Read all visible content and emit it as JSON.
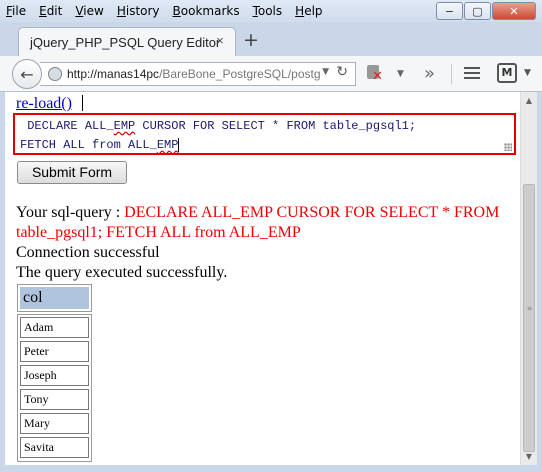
{
  "menubar": {
    "items": [
      {
        "label": "File",
        "mnemonic": "F",
        "rest": "ile"
      },
      {
        "label": "Edit",
        "mnemonic": "E",
        "rest": "dit"
      },
      {
        "label": "View",
        "mnemonic": "V",
        "rest": "iew"
      },
      {
        "label": "History",
        "mnemonic": "H",
        "rest": "istory"
      },
      {
        "label": "Bookmarks",
        "mnemonic": "B",
        "rest": "ookmarks"
      },
      {
        "label": "Tools",
        "mnemonic": "T",
        "rest": "ools"
      },
      {
        "label": "Help",
        "mnemonic": "H",
        "rest": "elp"
      }
    ]
  },
  "window_controls": {
    "minimize": "−",
    "maximize": "▢",
    "close": "✕"
  },
  "tab": {
    "title": "jQuery_PHP_PSQL Query Editor",
    "close": "×",
    "new_tab": "+"
  },
  "navbar": {
    "url_host": "http://manas14pc",
    "url_rest": "/BareBone_PostgreSQL/postg",
    "reload": "↻",
    "back": "←"
  },
  "page": {
    "reload_link": "re-load()",
    "query_line1_prefix": " DECLARE ALL_",
    "query_line1_spell": "EMP",
    "query_line1_suffix": " CURSOR FOR SELECT * FROM table_pgsql1;",
    "query_line2_prefix": "FETCH ALL from ALL_",
    "query_line2_spell": "EMP",
    "submit_label": "Submit Form",
    "sql_label": "Your sql-query : ",
    "sql_text": "DECLARE ALL_EMP CURSOR FOR SELECT * FROM table_pgsql1; FETCH ALL from ALL_EMP",
    "connection_status": "Connection successful",
    "query_status": "The query executed successfully.",
    "column_header": "col",
    "rows": [
      "Adam",
      "Peter",
      "Joseph",
      "Tony",
      "Mary",
      "Savita"
    ]
  },
  "colors": {
    "accent_red": "#ee0000",
    "header_bg": "#b0c4de",
    "link": "#0000cc"
  }
}
